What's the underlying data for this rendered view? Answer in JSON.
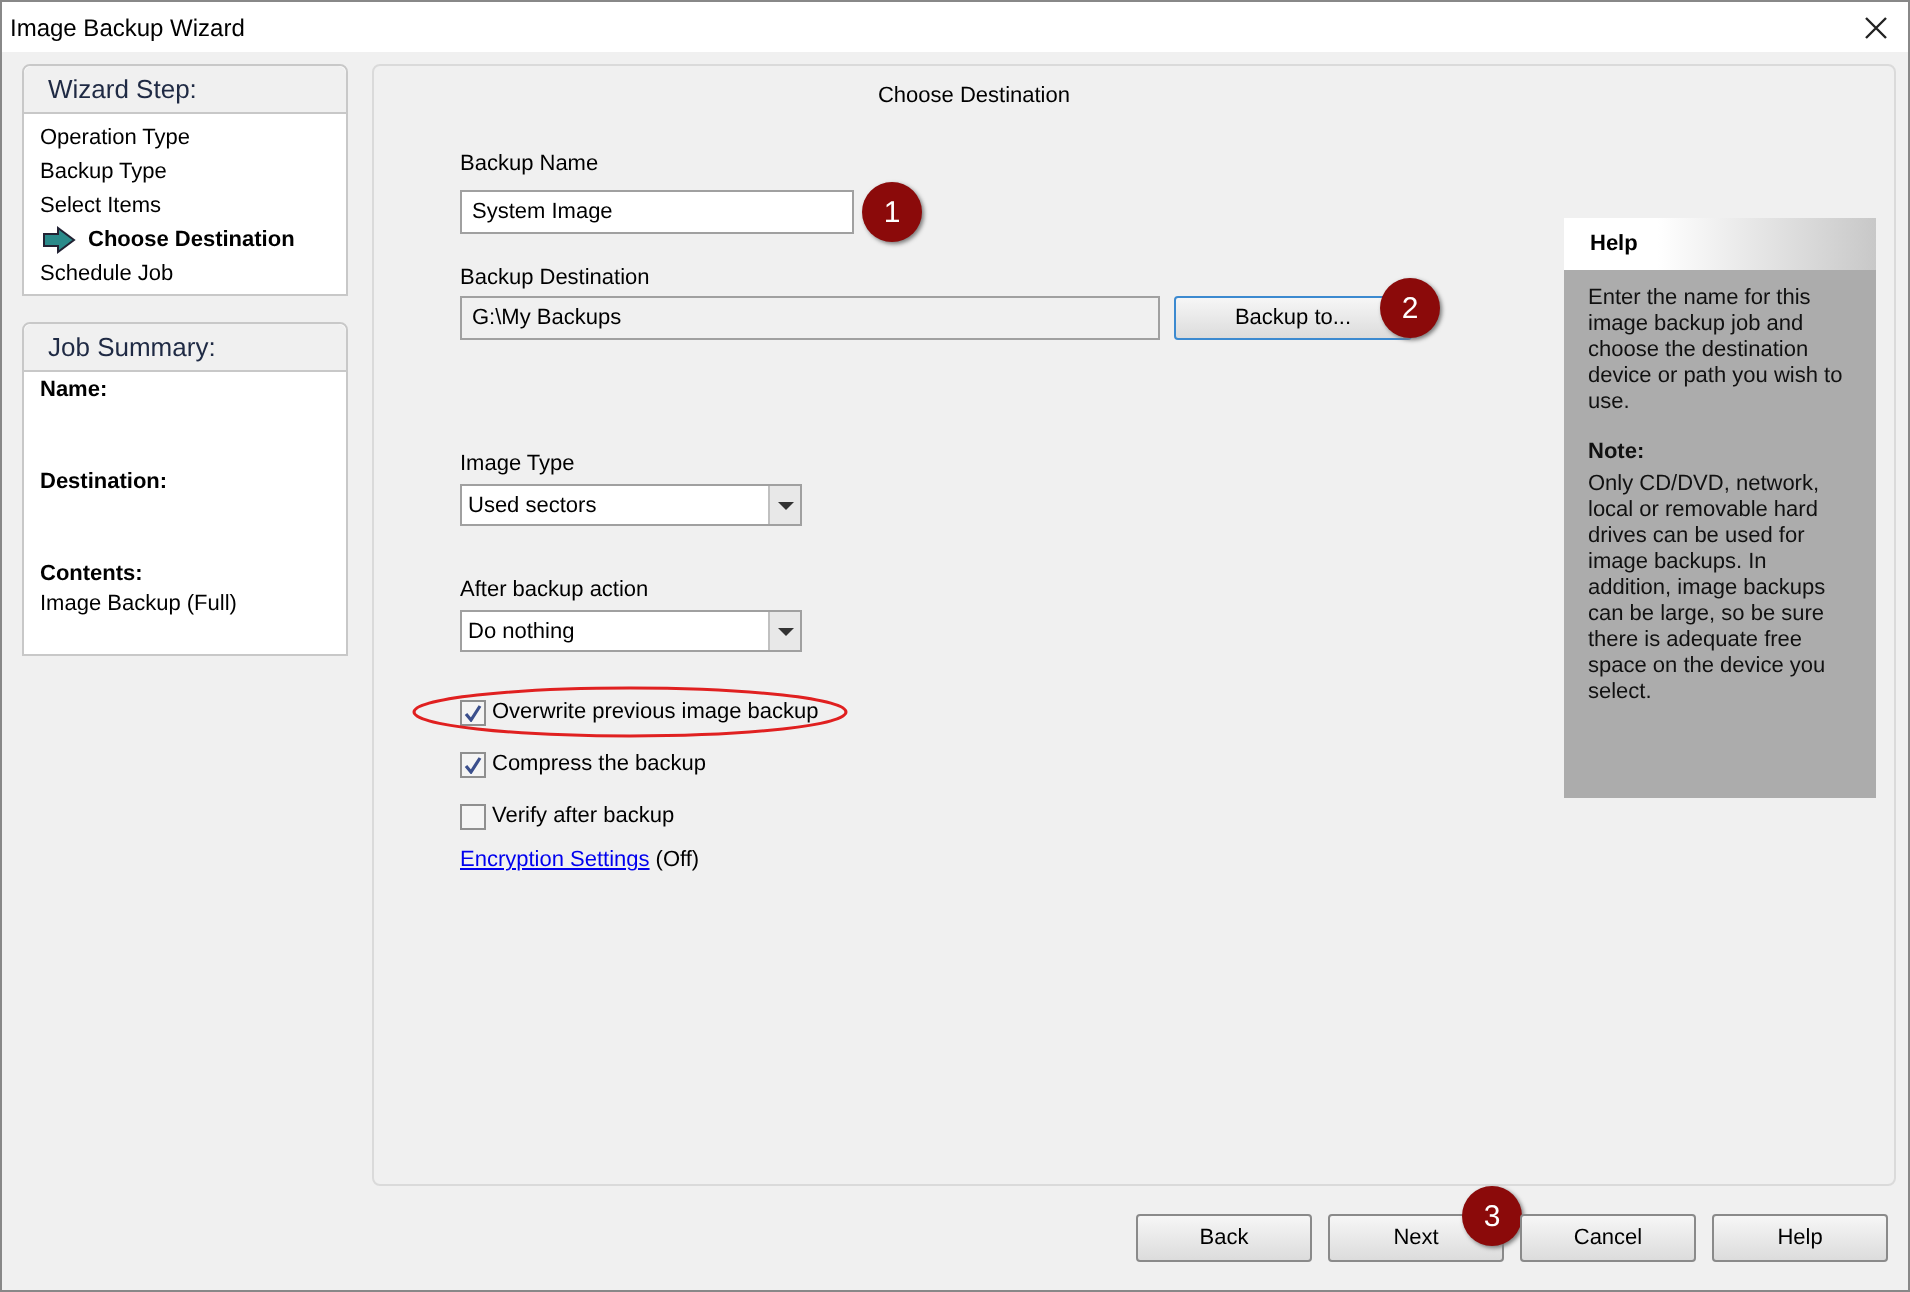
{
  "window": {
    "title": "Image Backup Wizard"
  },
  "wizard_steps": {
    "title": "Wizard Step:",
    "items": [
      {
        "label": "Operation Type",
        "selected": false
      },
      {
        "label": "Backup Type",
        "selected": false
      },
      {
        "label": "Select Items",
        "selected": false
      },
      {
        "label": "Choose Destination",
        "selected": true
      },
      {
        "label": "Schedule Job",
        "selected": false
      }
    ]
  },
  "job_summary": {
    "title": "Job Summary:",
    "fields": [
      {
        "label": "Name:"
      },
      {
        "label": "Destination:"
      },
      {
        "label": "Contents:",
        "value": "Image Backup (Full)"
      }
    ]
  },
  "heading": "Choose Destination",
  "backup_name": {
    "label": "Backup Name",
    "value": "System Image",
    "badge": "1"
  },
  "backup_destination": {
    "label": "Backup Destination",
    "value": "G:\\My Backups",
    "button": "Backup to...",
    "badge": "2"
  },
  "image_type": {
    "label": "Image Type",
    "value": "Used sectors"
  },
  "after_backup": {
    "label": "After backup action",
    "value": "Do nothing"
  },
  "options": [
    {
      "label": "Overwrite previous image backup",
      "checked": true,
      "highlighted": true
    },
    {
      "label": "Compress the backup",
      "checked": true,
      "highlighted": false
    },
    {
      "label": "Verify after backup",
      "checked": false,
      "highlighted": false
    }
  ],
  "encryption": {
    "link": "Encryption Settings",
    "status": "(Off)"
  },
  "help": {
    "title": "Help",
    "text": "Enter the name for this image backup job and choose the destination device or path you wish to use.",
    "note_title": "Note:",
    "note_text": "Only CD/DVD, network, local or removable hard drives can be used for image backups.  In addition, image backups can be large, so be sure there is adequate free space on the device you select."
  },
  "buttons": [
    {
      "label": "Back"
    },
    {
      "label": "Next",
      "badge": "3"
    },
    {
      "label": "Cancel"
    },
    {
      "label": "Help"
    }
  ]
}
